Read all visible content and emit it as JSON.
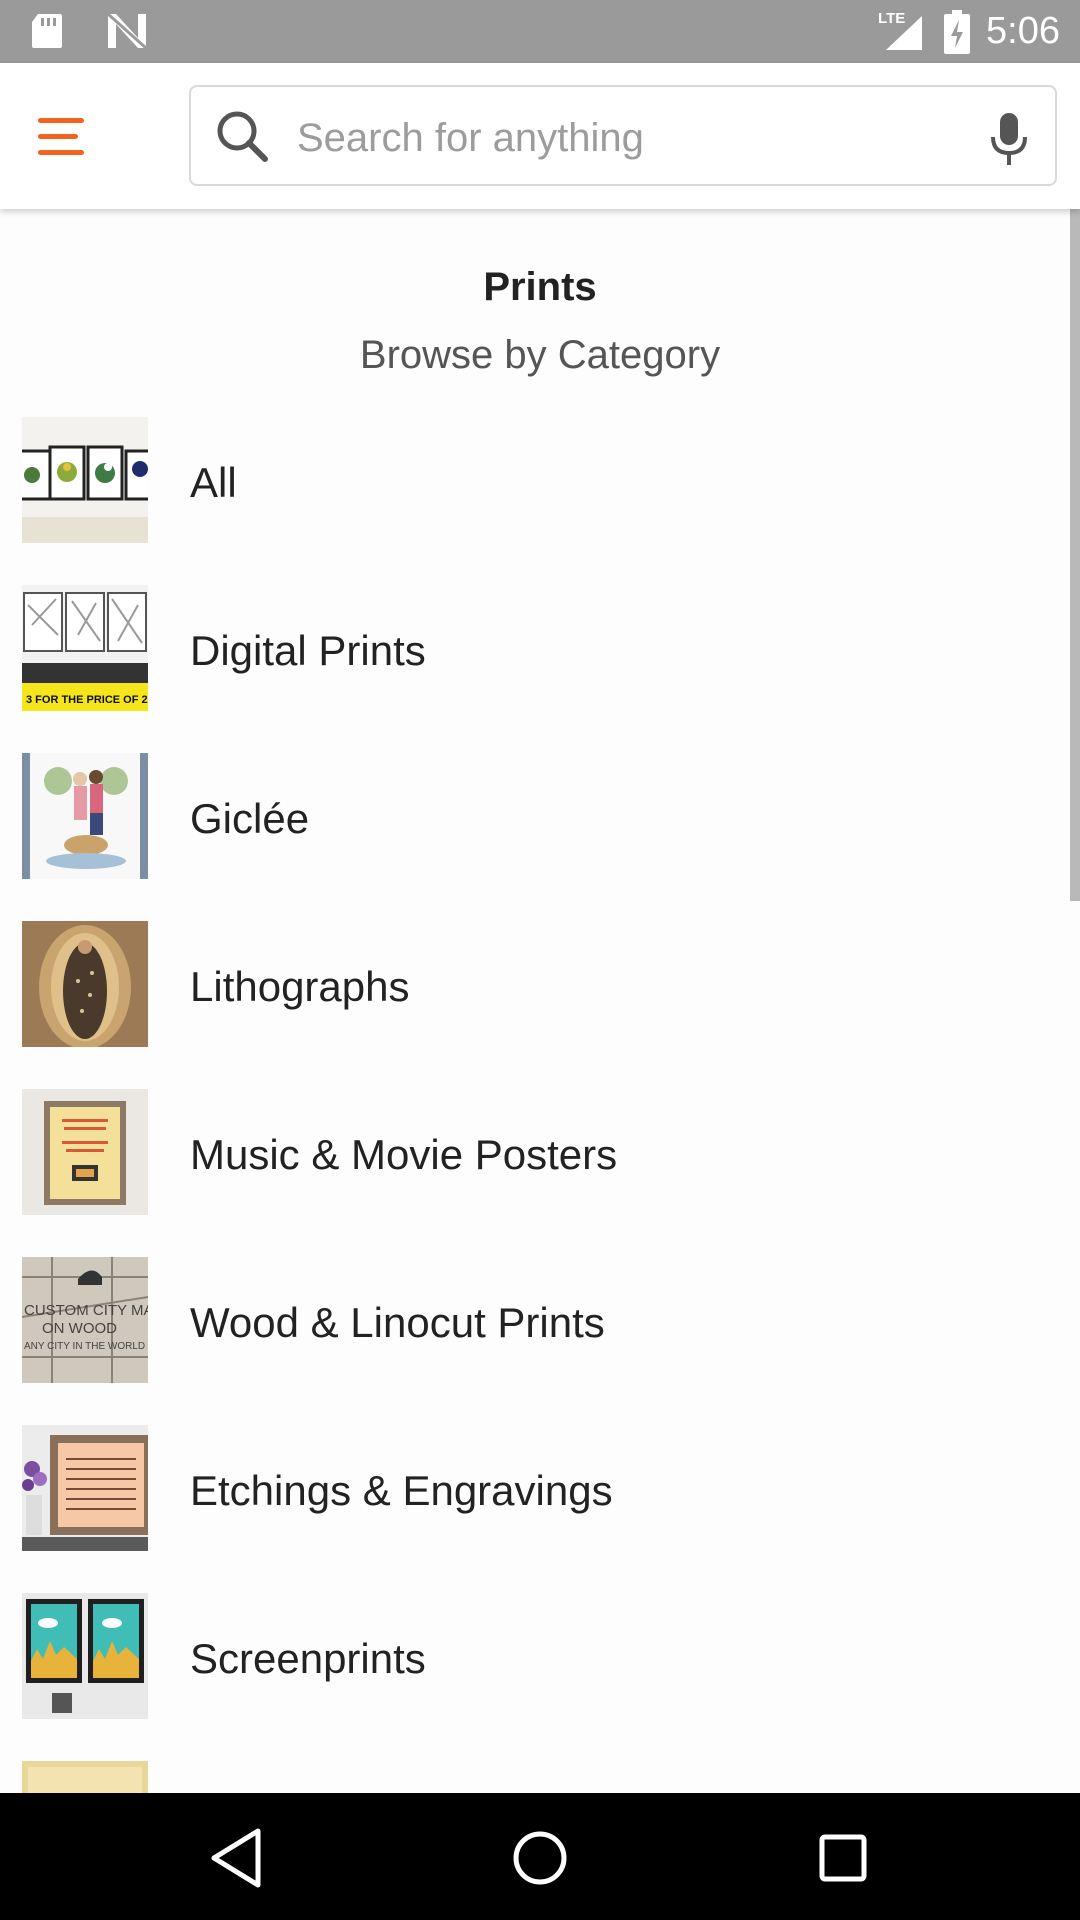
{
  "status_bar": {
    "time": "5:06",
    "network": "LTE",
    "icons": [
      "sd-card-icon",
      "n-logo-icon",
      "signal-icon",
      "battery-charging-icon"
    ]
  },
  "app_bar": {
    "menu_icon": "hamburger-menu-icon",
    "search_placeholder": "Search for anything",
    "search_value": "",
    "mic_icon": "microphone-icon"
  },
  "colors": {
    "accent": "#f1641e",
    "status_bar_bg": "#9a9a9a",
    "nav_bar_bg": "#000000"
  },
  "page": {
    "title": "Prints",
    "subtitle": "Browse by Category"
  },
  "categories": [
    {
      "label": "All",
      "thumb": "botanical-prints-thumb"
    },
    {
      "label": "Digital Prints",
      "thumb": "city-maps-thumb"
    },
    {
      "label": "Giclée",
      "thumb": "couple-illustration-thumb"
    },
    {
      "label": "Lithographs",
      "thumb": "virgin-guadalupe-thumb"
    },
    {
      "label": "Music & Movie Posters",
      "thumb": "framed-poster-thumb"
    },
    {
      "label": "Wood & Linocut Prints",
      "thumb": "wood-map-thumb"
    },
    {
      "label": "Etchings & Engravings",
      "thumb": "sheet-music-thumb"
    },
    {
      "label": "Screenprints",
      "thumb": "skyline-prints-thumb"
    }
  ],
  "nav_bar": {
    "icons": [
      "back-icon",
      "home-icon",
      "recents-icon"
    ]
  }
}
